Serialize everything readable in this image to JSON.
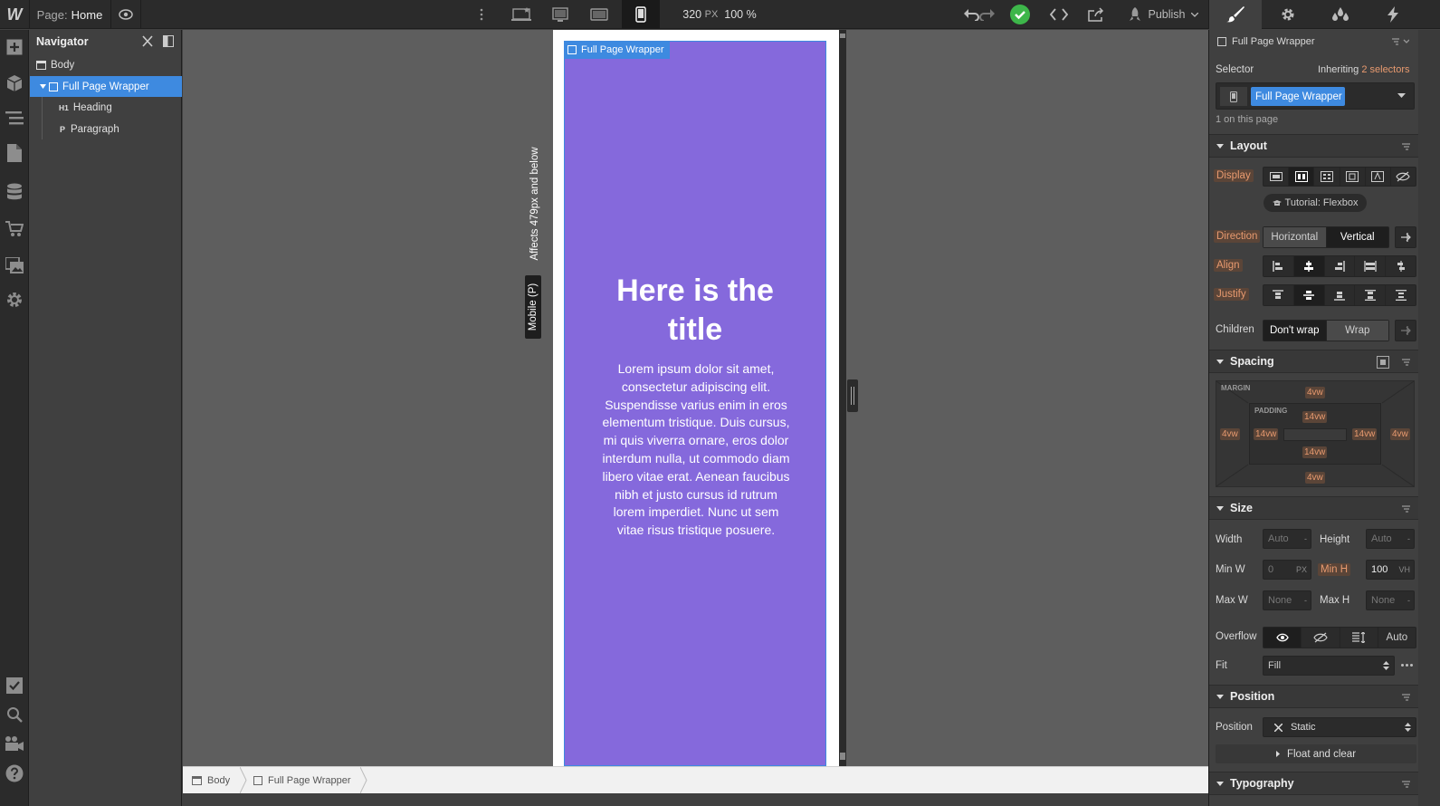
{
  "topbar": {
    "logo": "W",
    "page_prefix": "Page:",
    "page_name": "Home",
    "canvas_width": "320",
    "canvas_unit": "PX",
    "zoom": "100 %",
    "publish_label": "Publish",
    "panel_tabs": [
      "style-icon",
      "settings-icon",
      "interactions-icon",
      "lightning-icon"
    ]
  },
  "navigator": {
    "title": "Navigator",
    "items": [
      {
        "label": "Body",
        "tag": "body"
      },
      {
        "label": "Full Page Wrapper",
        "tag": "div",
        "selected": true
      },
      {
        "label": "Heading",
        "tag": "H1"
      },
      {
        "label": "Paragraph",
        "tag": "P"
      }
    ]
  },
  "canvas": {
    "breakpoint_note": "Affects 479px and below",
    "breakpoint_name": "Mobile (P)",
    "selected_label": "Full Page Wrapper",
    "heading": "Here is the title",
    "paragraph": "Lorem ipsum dolor sit amet, consectetur adipiscing elit. Suspendisse varius enim in eros elementum tristique. Duis cursus, mi quis viverra ornare, eros dolor interdum nulla, ut commodo diam libero vitae erat. Aenean faucibus nibh et justo cursus id rutrum lorem imperdiet. Nunc ut sem vitae risus tristique posuere.",
    "wrapper_color": "#8569dc"
  },
  "breadcrumb": {
    "items": [
      "Body",
      "Full Page Wrapper"
    ]
  },
  "panel": {
    "element_name": "Full Page Wrapper",
    "selector_label": "Selector",
    "inheriting_prefix": "Inheriting",
    "inheriting_count": "2 selectors",
    "selector_value": "Full Page Wrapper",
    "on_page": "1 on this page",
    "layout": {
      "title": "Layout",
      "display_label": "Display",
      "tutorial": "Tutorial: Flexbox",
      "direction_label": "Direction",
      "direction_options": [
        "Horizontal",
        "Vertical"
      ],
      "align_label": "Align",
      "justify_label": "Justify",
      "children_label": "Children",
      "children_options": [
        "Don't wrap",
        "Wrap"
      ]
    },
    "spacing": {
      "title": "Spacing",
      "margin_label": "MARGIN",
      "padding_label": "PADDING",
      "margin": {
        "top": "4vw",
        "right": "4vw",
        "bottom": "4vw",
        "left": "4vw"
      },
      "padding": {
        "top": "14vw",
        "right": "14vw",
        "bottom": "14vw",
        "left": "14vw"
      }
    },
    "size": {
      "title": "Size",
      "width_label": "Width",
      "width_value": "Auto",
      "width_unit": "-",
      "height_label": "Height",
      "height_value": "Auto",
      "height_unit": "-",
      "minw_label": "Min W",
      "minw_value": "0",
      "minw_unit": "PX",
      "minh_label": "Min H",
      "minh_value": "100",
      "minh_unit": "VH",
      "maxw_label": "Max W",
      "maxw_value": "None",
      "maxw_unit": "-",
      "maxh_label": "Max H",
      "maxh_value": "None",
      "maxh_unit": "-",
      "overflow_label": "Overflow",
      "overflow_auto": "Auto",
      "fit_label": "Fit",
      "fit_value": "Fill"
    },
    "position": {
      "title": "Position",
      "position_label": "Position",
      "position_value": "Static",
      "float_label": "Float and clear"
    },
    "typography": {
      "title": "Typography"
    }
  }
}
